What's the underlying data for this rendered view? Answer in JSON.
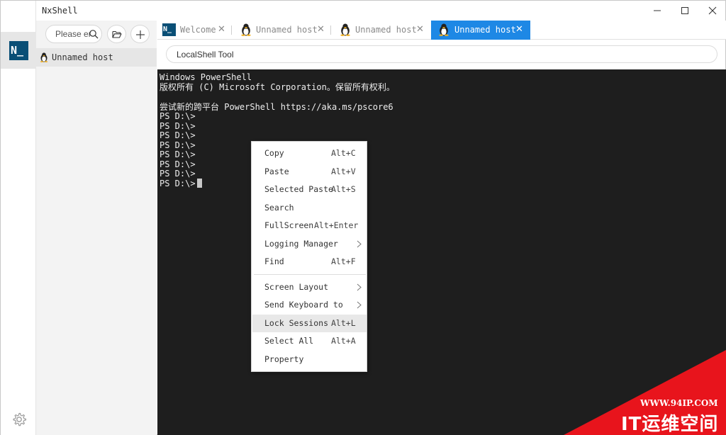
{
  "app": {
    "title": "NxShell",
    "logo_text": "N_"
  },
  "window_controls": {
    "minimize_icon": "minimize-icon",
    "maximize_icon": "maximize-icon",
    "close_icon": "close-icon"
  },
  "sidebar": {
    "search_placeholder": "Please en",
    "hosts": [
      {
        "label": "Unnamed host",
        "icon": "linux-tux-icon"
      }
    ]
  },
  "tabs": [
    {
      "label": "Welcome",
      "icon": "nxshell-logo-icon",
      "active": false,
      "logo_text": "N_"
    },
    {
      "label": "Unnamed host",
      "icon": "linux-tux-icon",
      "active": false
    },
    {
      "label": "Unnamed host",
      "icon": "linux-tux-icon",
      "active": false
    },
    {
      "label": "Unnamed host",
      "icon": "linux-tux-icon",
      "active": true
    }
  ],
  "tab_close_glyph": "✕",
  "toolbar": {
    "address": "LocalShell Tool"
  },
  "terminal": {
    "lines": [
      "Windows PowerShell",
      "版权所有 (C) Microsoft Corporation。保留所有权利。",
      "",
      "尝试新的跨平台 PowerShell https://aka.ms/pscore6",
      "PS D:\\>",
      "PS D:\\>",
      "PS D:\\>",
      "PS D:\\>",
      "PS D:\\>",
      "PS D:\\>",
      "PS D:\\>",
      "PS D:\\>"
    ]
  },
  "context_menu": {
    "items": [
      {
        "label": "Copy",
        "shortcut": "Alt+C"
      },
      {
        "label": "Paste",
        "shortcut": "Alt+V"
      },
      {
        "label": "Selected Paste",
        "shortcut": "Alt+S"
      },
      {
        "label": "Search",
        "shortcut": ""
      },
      {
        "label": "FullScreen",
        "shortcut": "Alt+Enter"
      },
      {
        "label": "Logging Manager",
        "shortcut": "",
        "submenu": true
      },
      {
        "label": "Find",
        "shortcut": "Alt+F"
      },
      {
        "label": "Screen Layout",
        "shortcut": "",
        "submenu": true
      },
      {
        "label": "Send Keyboard to",
        "shortcut": "",
        "submenu": true
      },
      {
        "label": "Lock Sessions",
        "shortcut": "Alt+L",
        "highlighted": true
      },
      {
        "label": "Select All",
        "shortcut": "Alt+A"
      },
      {
        "label": "Property",
        "shortcut": ""
      }
    ]
  },
  "watermark": {
    "url": "WWW.94IP.COM",
    "name": "IT运维空间",
    "color": "#e8141c"
  },
  "colors": {
    "accent": "#1e88e5",
    "terminal_bg": "#1e1e1e",
    "logo_bg": "#0a4f76"
  }
}
